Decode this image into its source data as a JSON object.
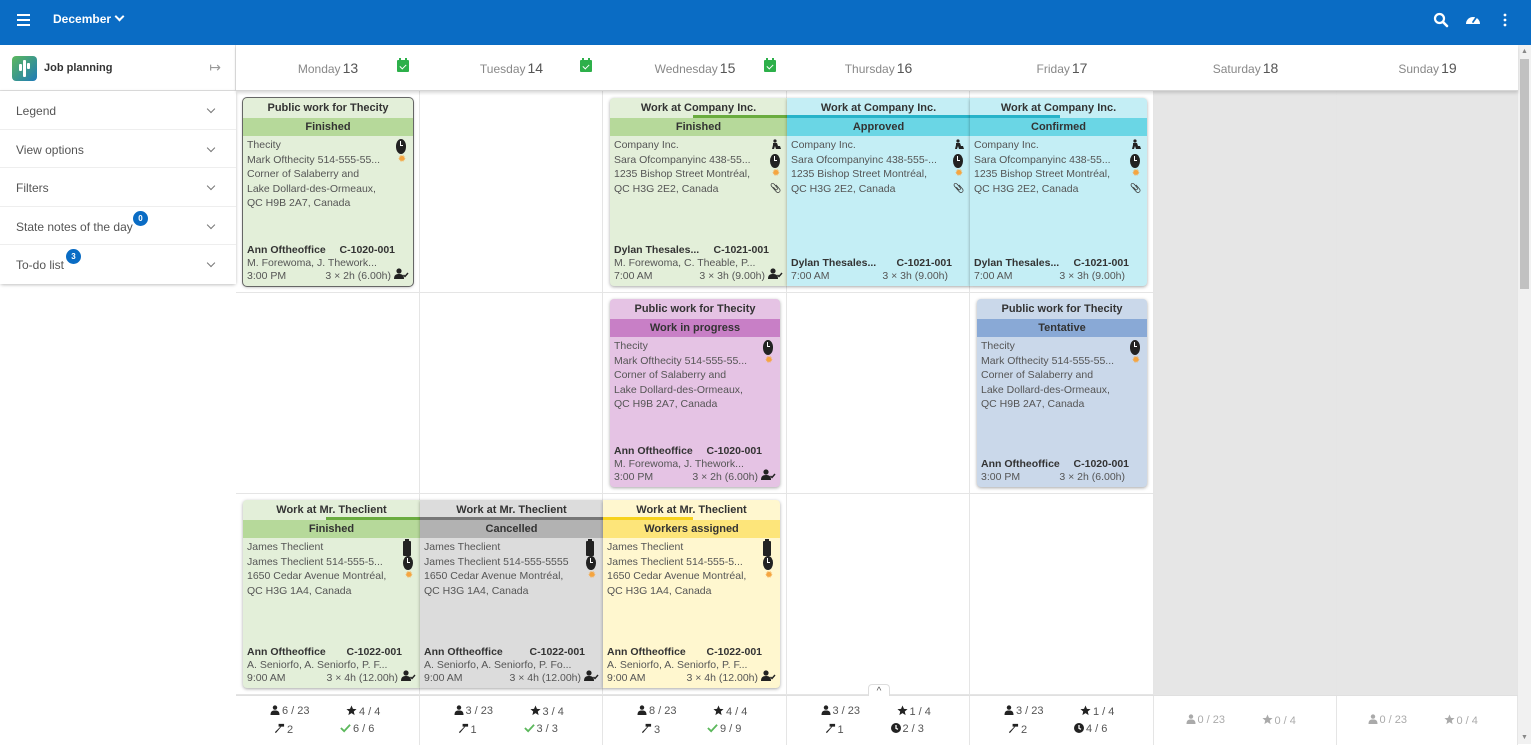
{
  "topbar": {
    "month_label": "December",
    "icons": [
      "menu-icon",
      "search-icon",
      "dashboard-gauge-icon",
      "more-vert-icon"
    ]
  },
  "sidebar": {
    "title": "Job planning",
    "collapse_icon": "collapse-right-icon",
    "items": [
      {
        "label": "Legend"
      },
      {
        "label": "View options"
      },
      {
        "label": "Filters"
      },
      {
        "label": "State notes of the day",
        "badge": "0"
      },
      {
        "label": "To-do list",
        "badge": "3"
      }
    ]
  },
  "days": [
    {
      "name": "Monday",
      "num": "13",
      "confirmed_icon": true
    },
    {
      "name": "Tuesday",
      "num": "14",
      "confirmed_icon": true
    },
    {
      "name": "Wednesday",
      "num": "15",
      "confirmed_icon": true
    },
    {
      "name": "Thursday",
      "num": "16",
      "confirmed_icon": false
    },
    {
      "name": "Friday",
      "num": "17",
      "confirmed_icon": false
    },
    {
      "name": "Saturday",
      "num": "18",
      "confirmed_icon": false
    },
    {
      "name": "Sunday",
      "num": "19",
      "confirmed_icon": false
    }
  ],
  "cards": [
    {
      "title": "Public work for Thecity",
      "state": "Finished",
      "lines": [
        "Thecity",
        "Mark Ofthecity 514-555-55...",
        "Corner of Salaberry and",
        "Lake Dollard-des-Ormeaux,",
        "QC H9B 2A7, Canada"
      ],
      "icons": [
        "clock",
        "sun"
      ],
      "owner": "Ann Oftheoffice",
      "job": "C-1020-001",
      "workers": "M. Forewoma, J. Thework...",
      "time": "3:00 PM",
      "duration": "3 × 2h (6.00h)",
      "assigned": true
    },
    {
      "title": "Work at Company Inc.",
      "state": "Finished",
      "lines": [
        "Company Inc.",
        "Sara Ofcompanyinc 438-55...",
        "1235 Bishop Street Montréal,",
        "QC H3G 2E2, Canada"
      ],
      "icons": [
        "worker",
        "clock",
        "sun",
        "clip"
      ],
      "owner": "Dylan Thesales...",
      "job": "C-1021-001",
      "workers": "M. Forewoma, C. Theable, P...",
      "time": "7:00 AM",
      "duration": "3 × 3h (9.00h)",
      "assigned": true
    },
    {
      "title": "Work at Company Inc.",
      "state": "Approved",
      "lines": [
        "Company Inc.",
        "Sara Ofcompanyinc 438-555-...",
        "1235 Bishop Street Montréal,",
        "QC H3G 2E2, Canada"
      ],
      "icons": [
        "worker",
        "clock",
        "sun",
        "clip"
      ],
      "owner": "Dylan Thesales...",
      "job": "C-1021-001",
      "workers": "",
      "time": "7:00 AM",
      "duration": "3 × 3h (9.00h)",
      "assigned": false
    },
    {
      "title": "Work at Company Inc.",
      "state": "Confirmed",
      "lines": [
        "Company Inc.",
        "Sara Ofcompanyinc 438-55...",
        "1235 Bishop Street Montréal,",
        "QC H3G 2E2, Canada"
      ],
      "icons": [
        "worker",
        "clock",
        "sun",
        "clip"
      ],
      "owner": "Dylan Thesales...",
      "job": "C-1021-001",
      "workers": "",
      "time": "7:00 AM",
      "duration": "3 × 3h (9.00h)",
      "assigned": false
    },
    {
      "title": "Public work for Thecity",
      "state": "Work in progress",
      "lines": [
        "Thecity",
        "Mark Ofthecity 514-555-55...",
        "Corner of Salaberry and",
        "Lake Dollard-des-Ormeaux,",
        "QC H9B 2A7, Canada"
      ],
      "icons": [
        "clock",
        "sun"
      ],
      "owner": "Ann Oftheoffice",
      "job": "C-1020-001",
      "workers": "M. Forewoma, J. Thework...",
      "time": "3:00 PM",
      "duration": "3 × 2h (6.00h)",
      "assigned": true
    },
    {
      "title": "Public work for Thecity",
      "state": "Tentative",
      "lines": [
        "Thecity",
        "Mark Ofthecity 514-555-55...",
        "Corner of Salaberry and",
        "Lake Dollard-des-Ormeaux,",
        "QC H9B 2A7, Canada"
      ],
      "icons": [
        "clock",
        "sun"
      ],
      "owner": "Ann Oftheoffice",
      "job": "C-1020-001",
      "workers": "",
      "time": "3:00 PM",
      "duration": "3 × 2h (6.00h)",
      "assigned": false
    },
    {
      "title": "Work at Mr. Theclient",
      "state": "Finished",
      "lines": [
        "James Theclient",
        "James Theclient 514-555-5...",
        "1650 Cedar Avenue Montréal,",
        "QC H3G 1A4, Canada"
      ],
      "icons": [
        "clipboard",
        "clock",
        "sun"
      ],
      "owner": "Ann Oftheoffice",
      "job": "C-1022-001",
      "workers": "A. Seniorfo, A. Seniorfo, P. F...",
      "time": "9:00 AM",
      "duration": "3 × 4h (12.00h)",
      "assigned": true
    },
    {
      "title": "Work at Mr. Theclient",
      "state": "Cancelled",
      "lines": [
        "James Theclient",
        "James Theclient 514-555-5555",
        "1650 Cedar Avenue Montréal,",
        "QC H3G 1A4, Canada"
      ],
      "icons": [
        "clipboard",
        "clock",
        "sun"
      ],
      "owner": "Ann Oftheoffice",
      "job": "C-1022-001",
      "workers": "A. Seniorfo, A. Seniorfo, P. Fo...",
      "time": "9:00 AM",
      "duration": "3 × 4h (12.00h)",
      "assigned": true
    },
    {
      "title": "Work at Mr. Theclient",
      "state": "Workers assigned",
      "lines": [
        "James Theclient",
        "James Theclient 514-555-5...",
        "1650 Cedar Avenue Montréal,",
        "QC H3G 1A4, Canada"
      ],
      "icons": [
        "clipboard",
        "clock",
        "sun"
      ],
      "owner": "Ann Oftheoffice",
      "job": "C-1022-001",
      "workers": "A. Seniorfo, A. Seniorfo, P. F...",
      "time": "9:00 AM",
      "duration": "3 × 4h (12.00h)",
      "assigned": true
    }
  ],
  "state_colors": {
    "Finished": {
      "bg": "#e3efd9",
      "band": "#b6d99a",
      "bar": "#6aac3f"
    },
    "Approved": {
      "bg": "#c4eef5",
      "band": "#6ad6e5",
      "bar": "#27b3c9"
    },
    "Confirmed": {
      "bg": "#c4eef5",
      "band": "#6ad6e5",
      "bar": "#27b3c9"
    },
    "Work in progress": {
      "bg": "#e5c3e4",
      "band": "#c87fc6",
      "bar": "#a64ca4"
    },
    "Tentative": {
      "bg": "#cad8ea",
      "band": "#89a9d6",
      "bar": "#5a7fb8"
    },
    "Cancelled": {
      "bg": "#dcdcdc",
      "band": "#b2b2b2",
      "bar": "#777777"
    },
    "Workers assigned": {
      "bg": "#fff7cf",
      "band": "#fde57a",
      "bar": "#f7d21b"
    }
  },
  "footer": [
    {
      "workers": "6 / 23",
      "stars": "4 / 4",
      "jobs": "2",
      "status_icon": "check",
      "status": "6 / 6"
    },
    {
      "workers": "3 / 23",
      "stars": "3 / 4",
      "jobs": "1",
      "status_icon": "check",
      "status": "3 / 3"
    },
    {
      "workers": "8 / 23",
      "stars": "4 / 4",
      "jobs": "3",
      "status_icon": "check",
      "status": "9 / 9"
    },
    {
      "workers": "3 / 23",
      "stars": "1 / 4",
      "jobs": "1",
      "status_icon": "clock",
      "status": "2 / 3"
    },
    {
      "workers": "3 / 23",
      "stars": "1 / 4",
      "jobs": "2",
      "status_icon": "clock",
      "status": "4 / 6"
    },
    {
      "workers": "0 / 23",
      "stars": "0 / 4"
    },
    {
      "workers": "0 / 23",
      "stars": "0 / 4"
    }
  ],
  "footer_toggle": "^"
}
